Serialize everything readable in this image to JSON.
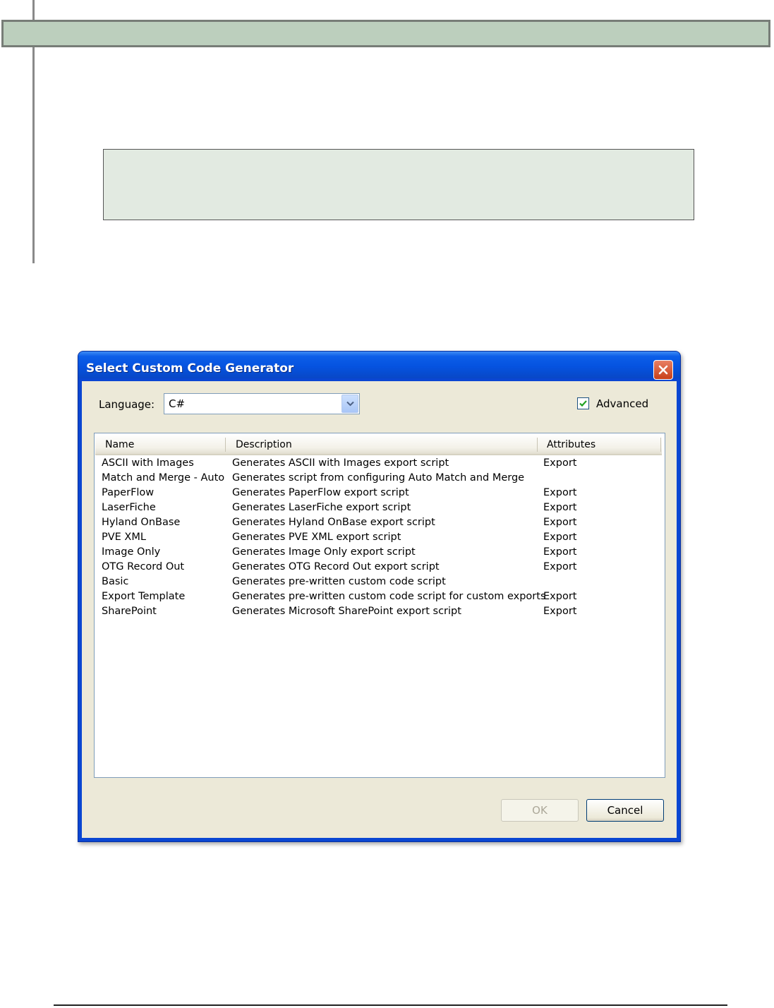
{
  "dialog": {
    "title": "Select Custom Code Generator",
    "language_label": "Language:",
    "language_value": "C#",
    "advanced_label": "Advanced",
    "advanced_checked": true,
    "columns": [
      "Name",
      "Description",
      "Attributes"
    ],
    "rows": [
      {
        "name": "ASCII with Images",
        "description": "Generates ASCII with Images export script",
        "attributes": "Export"
      },
      {
        "name": "Match and Merge - Auto",
        "description": "Generates script from configuring Auto Match and Merge",
        "attributes": ""
      },
      {
        "name": "PaperFlow",
        "description": "Generates PaperFlow export script",
        "attributes": "Export"
      },
      {
        "name": "LaserFiche",
        "description": "Generates LaserFiche export script",
        "attributes": "Export"
      },
      {
        "name": "Hyland OnBase",
        "description": "Generates Hyland OnBase export script",
        "attributes": "Export"
      },
      {
        "name": "PVE XML",
        "description": "Generates PVE XML export script",
        "attributes": "Export"
      },
      {
        "name": "Image Only",
        "description": "Generates Image Only export script",
        "attributes": "Export"
      },
      {
        "name": "OTG Record Out",
        "description": "Generates OTG Record Out export script",
        "attributes": "Export"
      },
      {
        "name": "Basic",
        "description": "Generates pre-written custom code script",
        "attributes": ""
      },
      {
        "name": "Export Template",
        "description": "Generates pre-written custom code script for custom exports",
        "attributes": "Export"
      },
      {
        "name": "SharePoint",
        "description": "Generates Microsoft SharePoint export script",
        "attributes": "Export"
      }
    ],
    "ok_label": "OK",
    "cancel_label": "Cancel",
    "colors": {
      "title_bar": "#0553e0",
      "client": "#ece9d8",
      "close_button": "#c9401a",
      "doc_header": "#bccfbd",
      "doc_note": "#e2eae1"
    }
  }
}
